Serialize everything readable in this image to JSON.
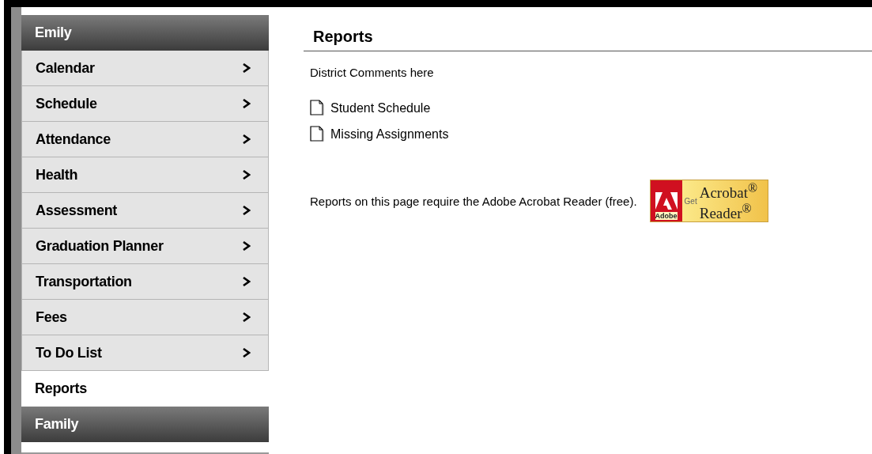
{
  "sidebar": {
    "sections": [
      {
        "title": "Emily",
        "items": [
          {
            "label": "Calendar",
            "selected": false
          },
          {
            "label": "Schedule",
            "selected": false
          },
          {
            "label": "Attendance",
            "selected": false
          },
          {
            "label": "Health",
            "selected": false
          },
          {
            "label": "Assessment",
            "selected": false
          },
          {
            "label": "Graduation Planner",
            "selected": false
          },
          {
            "label": "Transportation",
            "selected": false
          },
          {
            "label": "Fees",
            "selected": false
          },
          {
            "label": "To Do List",
            "selected": false
          },
          {
            "label": "Reports",
            "selected": true
          }
        ]
      },
      {
        "title": "Family"
      }
    ]
  },
  "content": {
    "title": "Reports",
    "comments": "District Comments here",
    "reports": [
      {
        "label": "Student Schedule"
      },
      {
        "label": "Missing Assignments"
      }
    ],
    "note": "Reports on this page require the Adobe Acrobat Reader (free).",
    "badge": {
      "maker": "Adobe",
      "get": "Get",
      "line1": "Acrobat$^{®}$",
      "line2": "Reader$^{®}$"
    }
  }
}
